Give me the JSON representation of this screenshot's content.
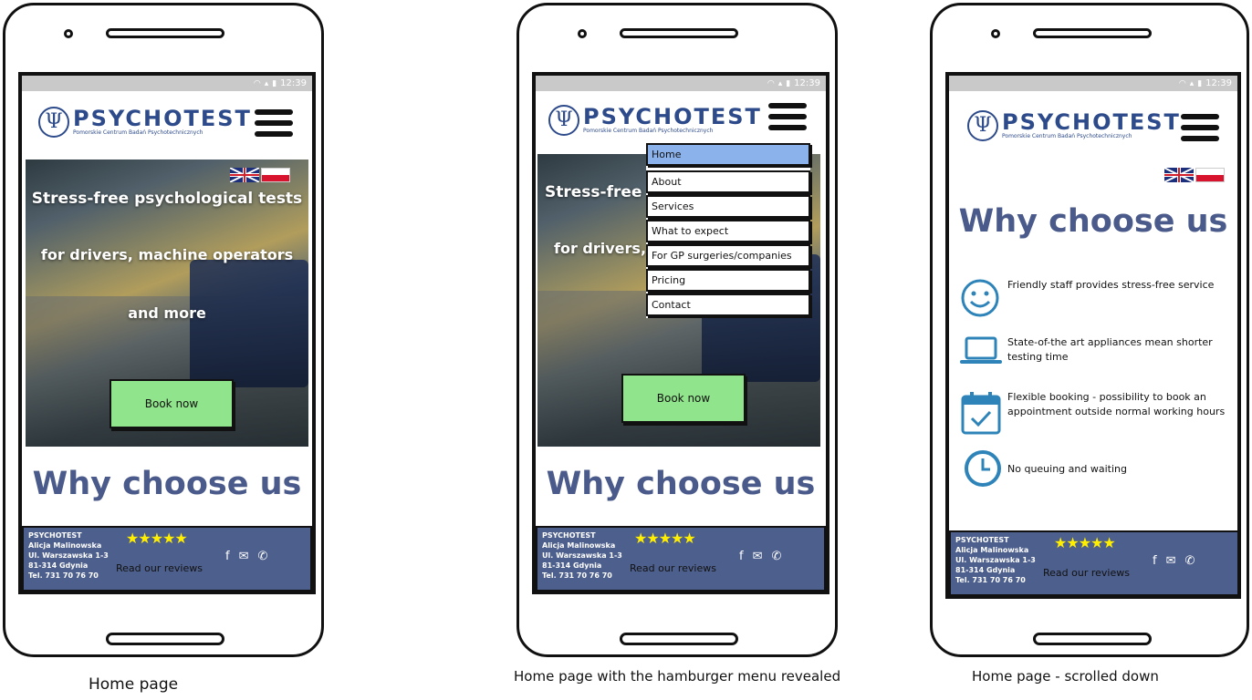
{
  "colors": {
    "brand": "#2d4a8a",
    "heading": "#4a5a8a",
    "footer": "#4d5f8c",
    "book_button": "#90e48b",
    "menu_active": "#8cb2ec",
    "stars": "#ffee00"
  },
  "status": {
    "time": "12:39"
  },
  "brand": {
    "name": "PSYCHOTEST",
    "tagline": "Pomorskie Centrum Badań Psychotechnicznych",
    "symbol": "Ψ"
  },
  "hero": {
    "line1": "Stress-free psychological tests",
    "line2": "for drivers, machine operators",
    "line3": "and more",
    "line1_cut": "Stress-free",
    "line2_cut": "for drivers,",
    "book_label": "Book now"
  },
  "why": {
    "title": "Why choose us"
  },
  "menu": {
    "items": [
      "Home",
      "About",
      "Services",
      "What to expect",
      "For GP surgeries/companies",
      "Pricing",
      "Contact"
    ],
    "active": "Home"
  },
  "features": [
    {
      "icon": "smiley-icon",
      "text": "Friendly staff provides stress-free service"
    },
    {
      "icon": "laptop-icon",
      "text": "State-of-the art appliances mean shorter testing time"
    },
    {
      "icon": "calendar-icon",
      "text": "Flexible booking - possibility to book an appointment outside normal working hours"
    },
    {
      "icon": "clock-icon",
      "text": "No queuing and waiting"
    }
  ],
  "footer": {
    "company": "PSYCHOTEST",
    "name": "Alicja Malinowska",
    "street": "Ul. Warszawska 1-3",
    "city": "81-314 Gdynia",
    "phone": "Tel. 731 70 76 70",
    "stars": "★★★★★",
    "rating": 5,
    "reviews_label": "Read our reviews",
    "social": [
      "facebook-icon",
      "mail-icon",
      "phone-icon"
    ]
  },
  "captions": {
    "phone1": "Home page",
    "phone2": "Home page with the hamburger menu revealed",
    "phone3": "Home page - scrolled down"
  }
}
